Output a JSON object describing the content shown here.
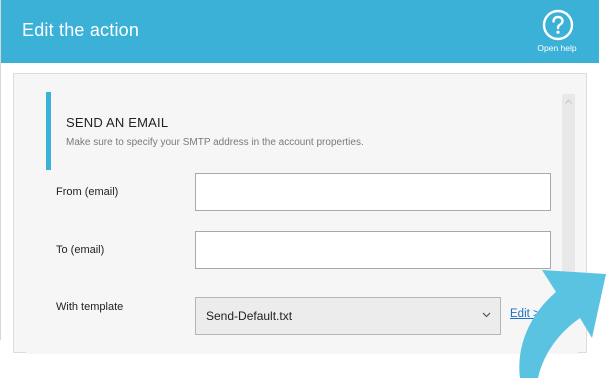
{
  "window": {
    "title": "Edit the action",
    "help_label": "Open help"
  },
  "section": {
    "title": "SEND AN EMAIL",
    "subtitle": "Make sure to specify your SMTP address in the account properties."
  },
  "form": {
    "from_label": "From (email)",
    "from_value": "",
    "to_label": "To (email)",
    "to_value": "",
    "template_label": "With template",
    "template_value": "Send-Default.txt",
    "edit_link": "Edit >"
  },
  "icons": {
    "help": "question-circle-icon",
    "dropdown": "chevron-down-icon",
    "scroll": "scroll-up-icon",
    "pointer": "curved-arrow-icon"
  },
  "colors": {
    "accent": "#3bb1d8",
    "link": "#1a6fc9",
    "arrow": "#5bc3e2"
  }
}
